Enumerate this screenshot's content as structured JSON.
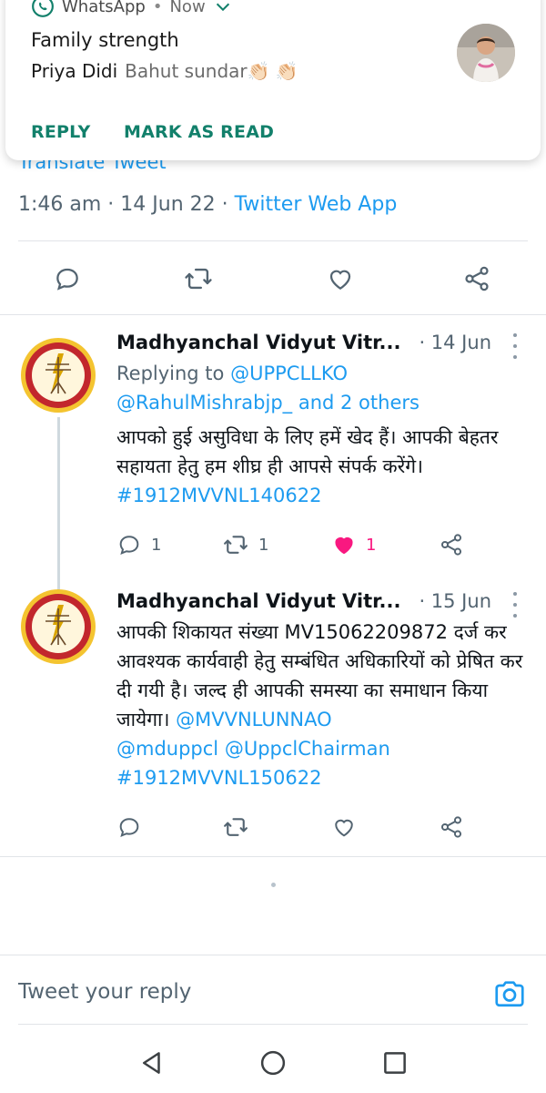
{
  "notification": {
    "app_name": "WhatsApp",
    "time": "Now",
    "title": "Family strength",
    "sender": "Priya Didi",
    "message": "Bahut sundar👏🏻 👏🏻",
    "actions": [
      "REPLY",
      "MARK AS READ"
    ]
  },
  "main_tweet": {
    "translate_label": "Translate Tweet",
    "timestamp": "1:46 am · 14 Jun 22 · ",
    "source": "Twitter Web App"
  },
  "replies": [
    {
      "author": "Madhyanchal Vidyut Vitr...",
      "date": "· 14 Jun",
      "replying_to_label": "Replying to ",
      "replying_to_1": "@UPPCLLKO",
      "replying_to_2": "@RahulMishrabjp_ and 2 others",
      "text": "आपको हुई असुविधा के लिए हमें खेद हैं। आपकी बेहतर सहायता हेतु हम शीघ्र ही आपसे संपर्क करेंगे।",
      "hashtag": "#1912MVVNL140622",
      "reply_count": "1",
      "retweet_count": "1",
      "like_count": "1",
      "liked": true
    },
    {
      "author": "Madhyanchal Vidyut Vitr...",
      "date": "· 15 Jun",
      "text": "आपकी शिकायत संख्या MV15062209872 दर्ज कर आवश्यक कार्यवाही हेतु सम्बंधित अधिकारियों को प्रेषित कर दी गयी है। जल्द ही आपकी समस्या का समाधान किया जायेगा।",
      "mention_1": "@MVVNLUNNAO",
      "mention_2": "@mduppcl",
      "mention_3": "@UppclChairman",
      "hashtag": "#1912MVVNL150622",
      "reply_count": "",
      "retweet_count": "",
      "like_count": "",
      "liked": false
    }
  ],
  "compose": {
    "placeholder": "Tweet your reply"
  },
  "icons": {
    "reply": "reply-icon",
    "retweet": "retweet-icon",
    "like": "like-icon",
    "share": "share-icon",
    "camera": "camera-icon",
    "back": "back-icon",
    "home": "home-icon",
    "recents": "recents-icon"
  },
  "colors": {
    "twitter_blue": "#1d9bf0",
    "like_pink": "#f91880",
    "whatsapp_green": "#12806b",
    "muted_text": "#536471"
  }
}
